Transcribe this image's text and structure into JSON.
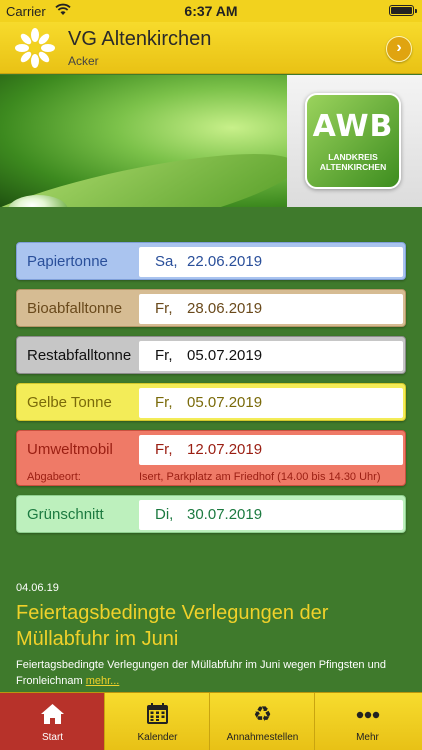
{
  "status_bar": {
    "carrier": "Carrier",
    "time": "6:37 AM"
  },
  "header": {
    "title": "VG Altenkirchen",
    "subtitle": "Acker",
    "next_icon": "chevron-right-icon",
    "accent": "#f2d21e"
  },
  "banner": {
    "logo_text": "AWB",
    "logo_subtext_line1": "LANDKREIS",
    "logo_subtext_line2": "ALTENKIRCHEN"
  },
  "schedule": [
    {
      "label": "Papiertonne",
      "day": "Sa,",
      "date": "22.06.2019",
      "bg": "#aac4ef",
      "border": "#7f9fd9",
      "fg": "#2a4f9a"
    },
    {
      "label": "Bioabfalltonne",
      "day": "Fr,",
      "date": "28.06.2019",
      "bg": "#d6bc93",
      "border": "#b59666",
      "fg": "#6a4a1c"
    },
    {
      "label": "Restabfalltonne",
      "day": "Fr,",
      "date": "05.07.2019",
      "bg": "#c6c6c6",
      "border": "#8c8c8c",
      "fg": "#111111"
    },
    {
      "label": "Gelbe Tonne",
      "day": "Fr,",
      "date": "05.07.2019",
      "bg": "#f3ec58",
      "border": "#d2c82a",
      "fg": "#7a6a0a"
    },
    {
      "label": "Umweltmobil",
      "day": "Fr,",
      "date": "12.07.2019",
      "bg": "#ef7a67",
      "border": "#c9503f",
      "fg": "#9a1e12",
      "extra_label": "Abgabeort:",
      "extra_value": "Isert, Parkplatz am Friedhof (14.00 bis 14.30 Uhr)"
    },
    {
      "label": "Grünschnitt",
      "day": "Di,",
      "date": "30.07.2019",
      "bg": "#bdf0bd",
      "border": "#8fd08f",
      "fg": "#1c7a40"
    }
  ],
  "news": {
    "date": "04.06.19",
    "headline": "Feiertagsbedingte Verlegungen der Müllabfuhr im Juni",
    "teaser": "Feiertagsbedingte Verlegungen der Müllabfuhr im Juni wegen Pfingsten und Fronleichnam",
    "more": "mehr..."
  },
  "tabs": [
    {
      "label": "Start",
      "icon": "home-icon",
      "glyph": "⌂",
      "active": true
    },
    {
      "label": "Kalender",
      "icon": "calendar-icon",
      "glyph": "▦",
      "active": false
    },
    {
      "label": "Annahmestellen",
      "icon": "recycle-icon",
      "glyph": "♻",
      "active": false
    },
    {
      "label": "Mehr",
      "icon": "more-icon",
      "glyph": "•••",
      "active": false
    }
  ]
}
